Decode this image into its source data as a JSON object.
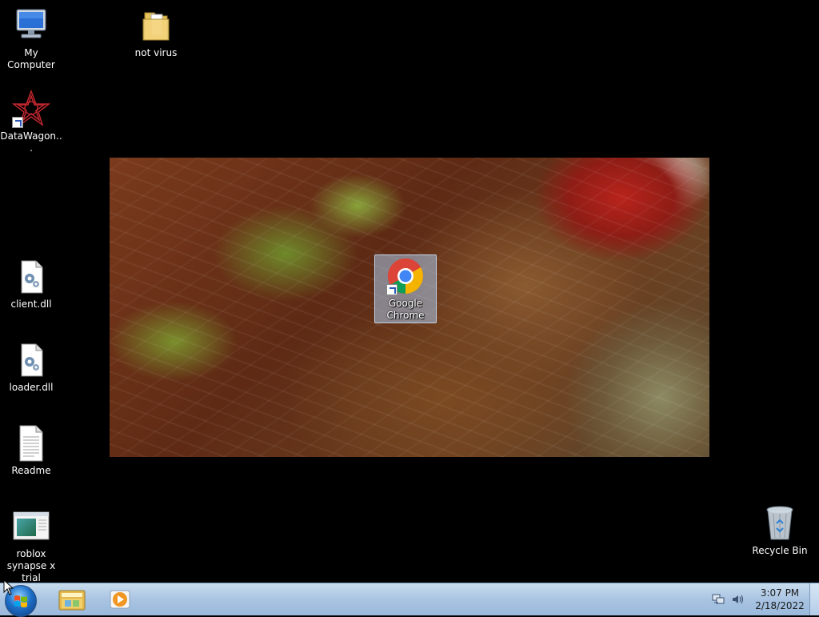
{
  "desktop": {
    "icons": [
      {
        "label": "My Computer",
        "icon": "computer-icon"
      },
      {
        "label": "not virus",
        "icon": "folder-icon"
      },
      {
        "label": "DataWagon...",
        "icon": "datawagon-shortcut-icon"
      },
      {
        "label": "client.dll",
        "icon": "dll-file-icon"
      },
      {
        "label": "loader.dll",
        "icon": "dll-file-icon"
      },
      {
        "label": "Readme",
        "icon": "text-file-icon"
      },
      {
        "label": "roblox synapse x trial",
        "icon": "application-window-icon"
      },
      {
        "label": "Google Chrome",
        "icon": "chrome-shortcut-icon"
      },
      {
        "label": "Recycle Bin",
        "icon": "recycle-bin-icon"
      }
    ]
  },
  "taskbar": {
    "clock_time": "3:07 PM",
    "clock_date": "2/18/2022",
    "pinned": [
      "windows-explorer-icon",
      "media-player-icon"
    ]
  },
  "colors": {
    "taskbar": "#a9c4e2",
    "desktop_bg": "#000000",
    "selection": "#aac8eb"
  }
}
